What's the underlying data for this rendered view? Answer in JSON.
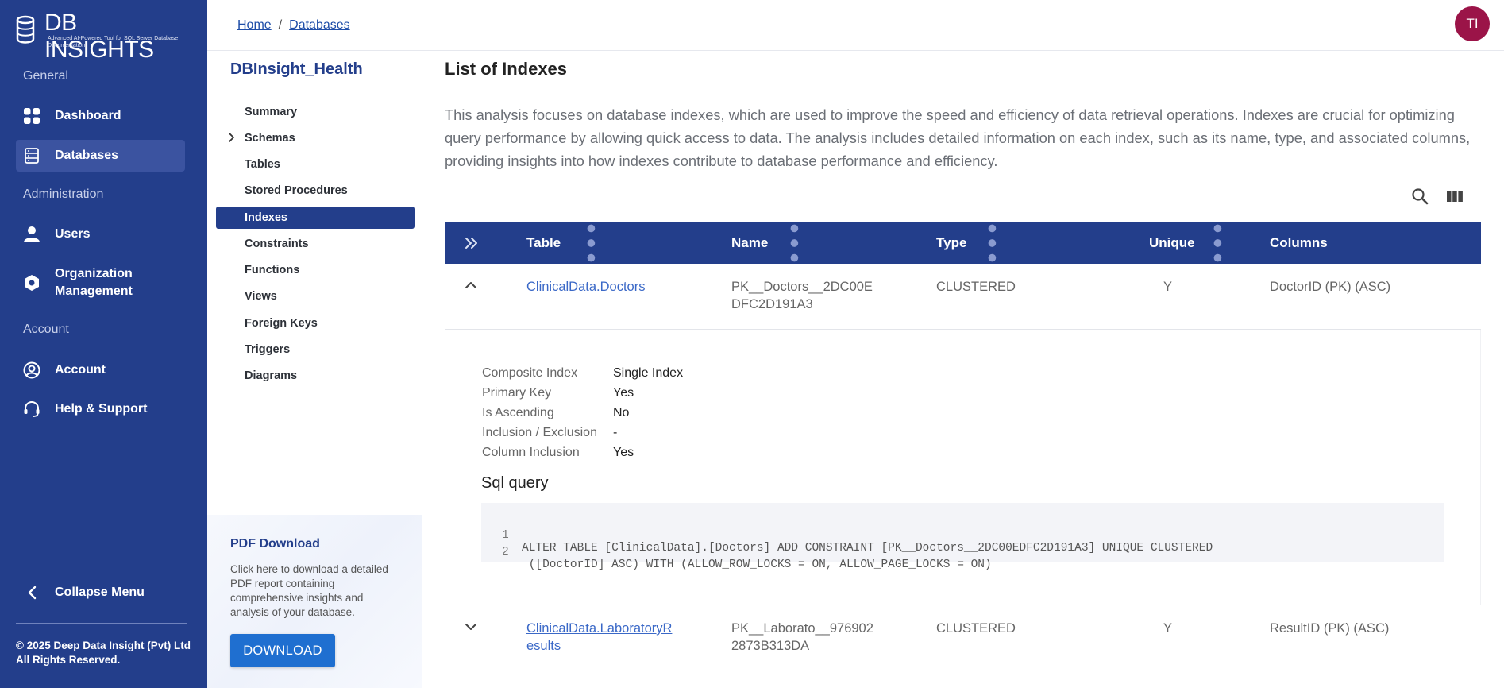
{
  "app": {
    "name": "DB INSIGHTS",
    "tagline": "Advanced AI-Powered Tool for SQL Server Database Documentation"
  },
  "sidebar": {
    "sections": {
      "general": "General",
      "administration": "Administration",
      "account": "Account"
    },
    "items": [
      {
        "label": "Dashboard",
        "icon": "dashboard-icon"
      },
      {
        "label": "Databases",
        "icon": "database-icon"
      },
      {
        "label": "Users",
        "icon": "user-icon"
      },
      {
        "label": "Organization Management",
        "icon": "organization-icon"
      },
      {
        "label": "Account",
        "icon": "account-circle-icon"
      },
      {
        "label": "Help & Support",
        "icon": "headset-icon"
      }
    ],
    "collapse_label": "Collapse Menu",
    "copyright": "© 2025 Deep Data Insight (Pvt) Ltd All Rights Reserved."
  },
  "header": {
    "breadcrumb": [
      "Home",
      "Databases"
    ],
    "breadcrumb_separator": "/",
    "avatar_initials": "TI",
    "avatar_color": "#9b1448"
  },
  "subnav": {
    "database_name": "DBInsight_Health",
    "items": [
      "Summary",
      "Schemas",
      "Tables",
      "Stored Procedures",
      "Indexes",
      "Constraints",
      "Functions",
      "Views",
      "Foreign Keys",
      "Triggers",
      "Diagrams"
    ],
    "active": "Indexes"
  },
  "pdf": {
    "title": "PDF Download",
    "description": "Click here to download a detailed PDF report containing comprehensive insights and analysis of your database.",
    "button_label": "DOWNLOAD"
  },
  "main": {
    "title": "List of Indexes",
    "description": "This analysis focuses on database indexes, which are used to improve the speed and efficiency of data retrieval operations. Indexes are crucial for optimizing query performance by allowing quick access to data. The analysis includes detailed information on each index, such as its name, type, and associated columns, providing insights into how indexes contribute to database performance and efficiency.",
    "table": {
      "columns": [
        "Table",
        "Name",
        "Type",
        "Unique",
        "Columns"
      ],
      "rows": [
        {
          "table_line1": "ClinicalData.Doctors",
          "table_line2": "",
          "name_line1": "PK__Doctors__2DC00E",
          "name_line2": "DFC2D191A3",
          "type": "CLUSTERED",
          "unique": "Y",
          "columns": "DoctorID (PK) (ASC)",
          "expanded": true
        },
        {
          "table_line1": "ClinicalData.LaboratoryR",
          "table_line2": "esults",
          "name_line1": "PK__Laborato__976902",
          "name_line2": "2873B313DA",
          "type": "CLUSTERED",
          "unique": "Y",
          "columns": "ResultID (PK) (ASC)",
          "expanded": false
        }
      ],
      "detail": {
        "fields": [
          {
            "label": "Composite Index",
            "value": "Single Index"
          },
          {
            "label": "Primary Key",
            "value": "Yes"
          },
          {
            "label": "Is Ascending",
            "value": "No"
          },
          {
            "label": "Inclusion / Exclusion",
            "value": "-"
          },
          {
            "label": "Column Inclusion",
            "value": "Yes"
          }
        ],
        "sql_title": "Sql query",
        "sql_lines": [
          {
            "n": "1",
            "text": "ALTER TABLE [ClinicalData].[Doctors] ADD CONSTRAINT [PK__Doctors__2DC00EDFC2D191A3] UNIQUE CLUSTERED"
          },
          {
            "n": "2",
            "text": " ([DoctorID] ASC) WITH (ALLOW_ROW_LOCKS = ON, ALLOW_PAGE_LOCKS = ON)"
          }
        ]
      }
    }
  },
  "colors": {
    "navy": "#233e8b",
    "link": "#3a68c7",
    "download": "#1f6fd0"
  }
}
